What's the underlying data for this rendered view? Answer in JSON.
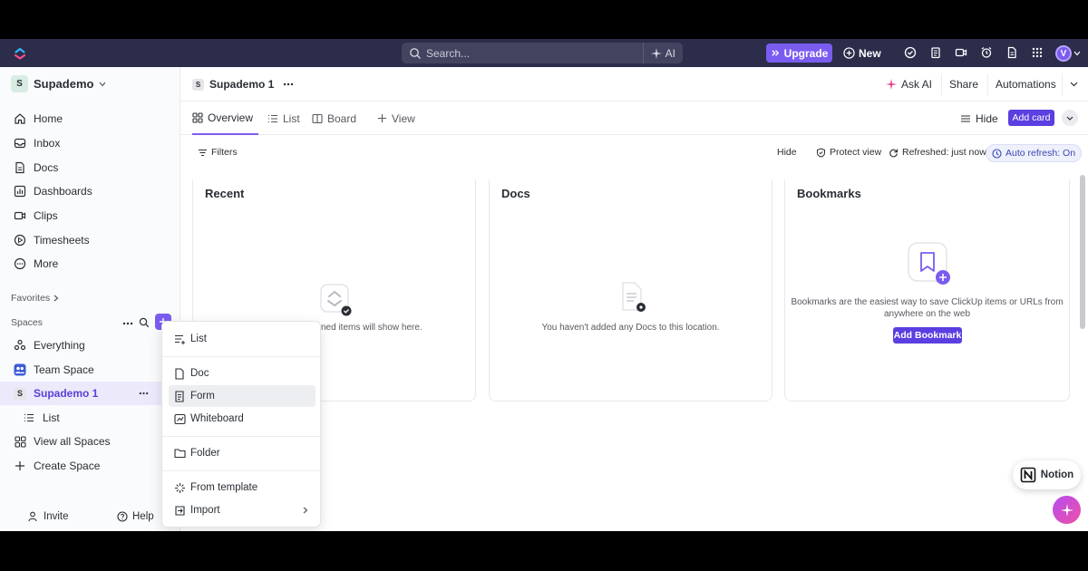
{
  "topbar": {
    "search_placeholder": "Search...",
    "ai_label": "AI",
    "upgrade_label": "Upgrade",
    "new_label": "New",
    "avatar_initial": "V",
    "accent": "#7b5cf0",
    "bar_color": "#2b2d4a"
  },
  "sidebar": {
    "workspace_badge": "S",
    "workspace_name": "Supademo",
    "nav": [
      {
        "label": "Home",
        "icon": "home-icon"
      },
      {
        "label": "Inbox",
        "icon": "inbox-icon"
      },
      {
        "label": "Docs",
        "icon": "docs-icon"
      },
      {
        "label": "Dashboards",
        "icon": "dashboards-icon"
      },
      {
        "label": "Clips",
        "icon": "clips-icon"
      },
      {
        "label": "Timesheets",
        "icon": "timesheets-icon"
      },
      {
        "label": "More",
        "icon": "more-icon"
      }
    ],
    "favorites_label": "Favorites",
    "spaces_label": "Spaces",
    "spaces": {
      "everything": "Everything",
      "team_space": "Team Space",
      "supademo_badge": "S",
      "supademo": "Supademo 1",
      "list": "List",
      "view_all": "View all Spaces",
      "create": "Create Space"
    },
    "invite_label": "Invite",
    "help_label": "Help"
  },
  "header": {
    "crumb_badge": "S",
    "crumb_title": "Supademo 1",
    "ask_ai": "Ask AI",
    "share": "Share",
    "automations": "Automations"
  },
  "tabs": {
    "overview": "Overview",
    "list": "List",
    "board": "Board",
    "view": "View",
    "hide": "Hide",
    "add_card": "Add card"
  },
  "filters": {
    "filters": "Filters",
    "hide": "Hide",
    "protect_view": "Protect view",
    "refreshed": "Refreshed: just now",
    "auto_refresh": "Auto refresh: On"
  },
  "cards": {
    "recent_title": "Recent",
    "recent_msg": "ned items will show here.",
    "docs_title": "Docs",
    "docs_msg": "You haven't added any Docs to this location.",
    "bookmarks_title": "Bookmarks",
    "bookmarks_msg_1": "Bookmarks are the easiest way to save ClickUp items or URLs from",
    "bookmarks_msg_2": "anywhere on the web",
    "add_bookmark": "Add Bookmark"
  },
  "menu": {
    "items": [
      {
        "label": "List",
        "icon": "list-icon"
      },
      {
        "label": "Doc",
        "icon": "doc-icon"
      },
      {
        "label": "Form",
        "icon": "form-icon"
      },
      {
        "label": "Whiteboard",
        "icon": "whiteboard-icon"
      },
      {
        "label": "Folder",
        "icon": "folder-icon"
      },
      {
        "label": "From template",
        "icon": "template-icon"
      },
      {
        "label": "Import",
        "icon": "import-icon"
      }
    ]
  },
  "notion_label": "Notion"
}
